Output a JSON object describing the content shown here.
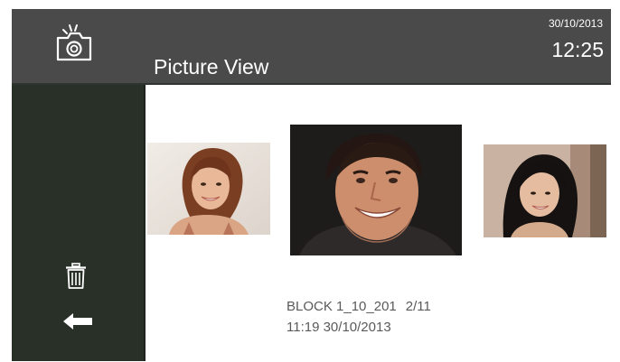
{
  "header": {
    "title": "Picture View",
    "date": "30/10/2013",
    "time": "12:25",
    "icon": "camera-icon"
  },
  "sidebar": {
    "items": [
      {
        "name": "delete",
        "icon": "trash-icon"
      },
      {
        "name": "back",
        "icon": "back-arrow-icon"
      }
    ]
  },
  "gallery": {
    "photos": [
      {
        "position": "previous",
        "subject": "woman with auburn hair"
      },
      {
        "position": "current",
        "subject": "smiling man with dark hair"
      },
      {
        "position": "next",
        "subject": "smiling woman with long black hair"
      }
    ],
    "file_name": "BLOCK 1_10_201",
    "counter": "2/11",
    "timestamp": "11:19 30/10/2013"
  },
  "colors": {
    "header_bg": "#4a4a4a",
    "sidebar_bg": "#283028",
    "text_light": "#ffffff",
    "text_info": "#5a5a5a"
  }
}
